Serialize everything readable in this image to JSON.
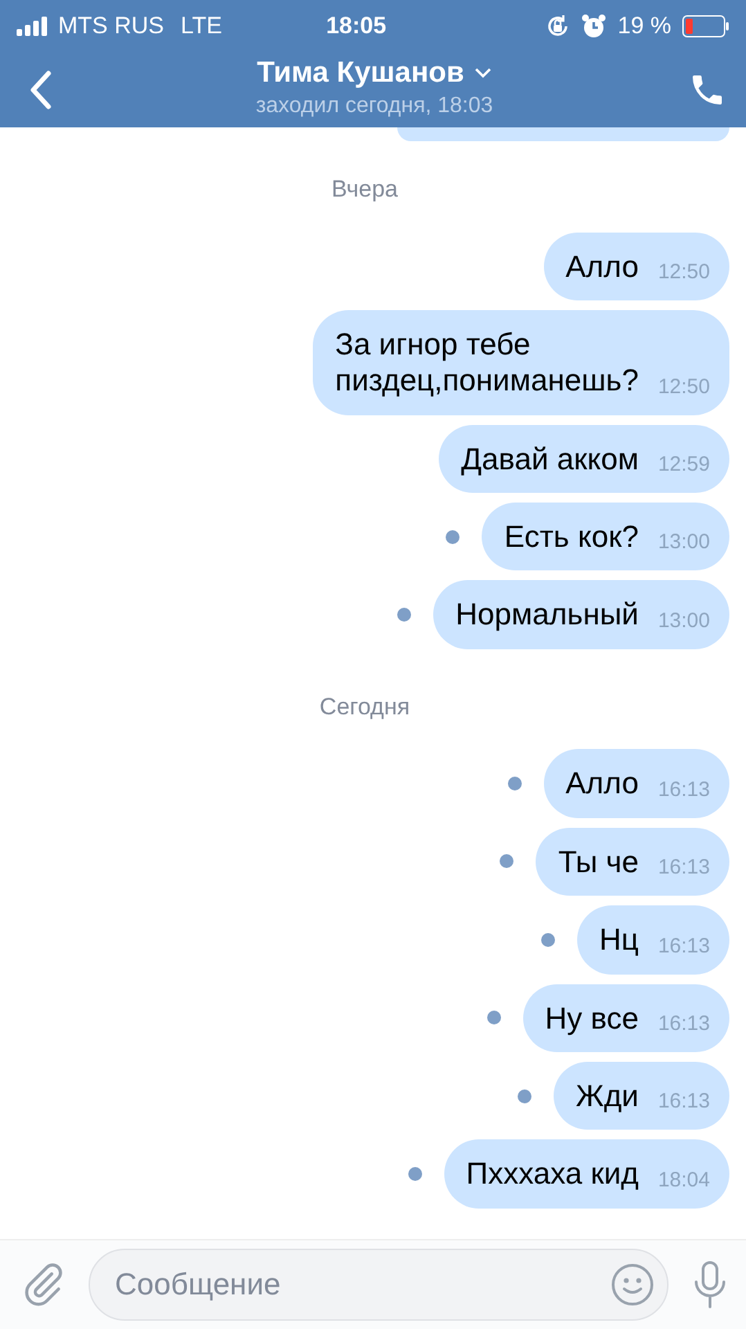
{
  "status_bar": {
    "carrier": "MTS RUS",
    "network": "LTE",
    "time": "18:05",
    "battery": "19 %"
  },
  "header": {
    "title": "Тима Кушанов",
    "subtitle": "заходил сегодня, 18:03"
  },
  "messages": [
    {
      "kind": "date",
      "text": "Вчера"
    },
    {
      "kind": "out",
      "text": "Алло",
      "time": "12:50",
      "unread": false
    },
    {
      "kind": "out",
      "text": "За игнор тебе\nпиздец,пониманешь?",
      "time": "12:50",
      "unread": false
    },
    {
      "kind": "out",
      "text": "Давай акком",
      "time": "12:59",
      "unread": false
    },
    {
      "kind": "out",
      "text": "Есть кок?",
      "time": "13:00",
      "unread": true
    },
    {
      "kind": "out",
      "text": "Нормальный",
      "time": "13:00",
      "unread": true
    },
    {
      "kind": "date",
      "text": "Сегодня"
    },
    {
      "kind": "out",
      "text": "Алло",
      "time": "16:13",
      "unread": true
    },
    {
      "kind": "out",
      "text": "Ты че",
      "time": "16:13",
      "unread": true
    },
    {
      "kind": "out",
      "text": "Нц",
      "time": "16:13",
      "unread": true
    },
    {
      "kind": "out",
      "text": "Ну все",
      "time": "16:13",
      "unread": true
    },
    {
      "kind": "out",
      "text": "Жди",
      "time": "16:13",
      "unread": true
    },
    {
      "kind": "out",
      "text": "Пхххаха кид",
      "time": "18:04",
      "unread": true
    }
  ],
  "composer": {
    "placeholder": "Сообщение"
  }
}
